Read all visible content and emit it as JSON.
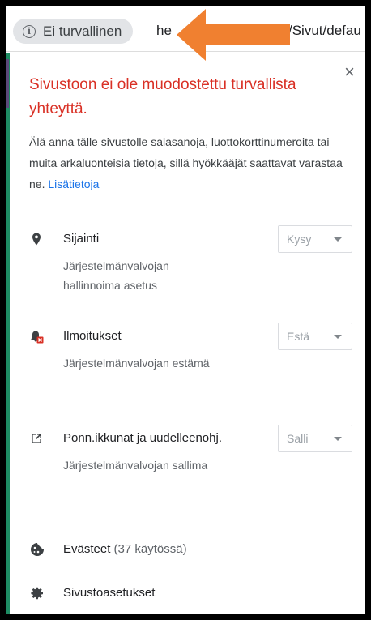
{
  "address_bar": {
    "security_label": "Ei turvallinen",
    "url_visible_start": "he",
    "url_visible_end": "/Sivut/defau"
  },
  "annotation": {
    "arrow_color": "#f08030"
  },
  "popup": {
    "title": "Sivustoon ei ole muodostettu turvallista yhteyttä.",
    "body": "Älä anna tälle sivustolle salasanoja, luottokorttinumeroita tai muita arkaluonteisia tietoja, sillä hyökkääjät saattavat varastaa ne.",
    "learn_more": "Lisätietoja",
    "close_label": "×",
    "warning_color": "#d93025",
    "link_color": "#1a73e8"
  },
  "permissions": [
    {
      "label": "Sijainti",
      "sub": "Järjestelmänvalvojan hallinnoima asetus",
      "value": "Kysy",
      "icon": "location-pin-icon"
    },
    {
      "label": "Ilmoitukset",
      "sub": "Järjestelmänvalvojan estämä",
      "value": "Estä",
      "icon": "notification-blocked-icon"
    },
    {
      "label": "Ponn.ikkunat ja uudelleenohj.",
      "sub": "Järjestelmänvalvojan sallima",
      "value": "Salli",
      "icon": "popup-redirect-icon"
    }
  ],
  "footer": {
    "cookies_label": "Evästeet",
    "cookies_count": "(37 käytössä)",
    "site_settings_label": "Sivustoasetukset"
  }
}
